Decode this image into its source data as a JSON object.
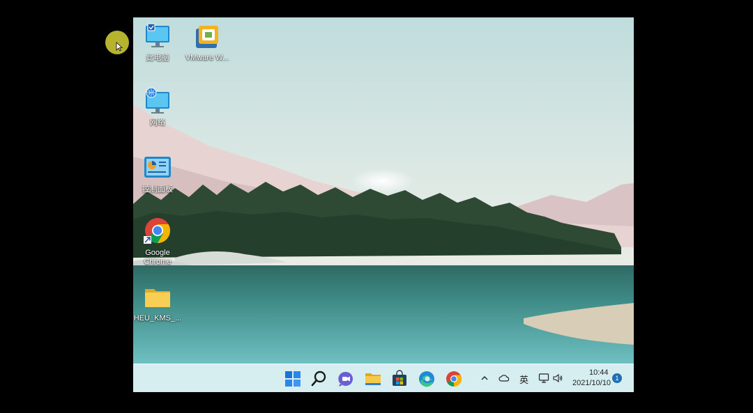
{
  "desktop": {
    "icons": [
      {
        "label": "此电脑",
        "icon": "computer-icon"
      },
      {
        "label": "VMware W...",
        "icon": "vmware-icon"
      },
      {
        "label": "网络",
        "icon": "network-icon"
      },
      {
        "label": "控制面板",
        "icon": "control-panel-icon"
      },
      {
        "label": "Google",
        "label2": "Chrome",
        "icon": "chrome-icon"
      },
      {
        "label": "HEU_KMS_...",
        "icon": "folder-icon"
      }
    ]
  },
  "taskbar": {
    "apps": [
      "start-icon",
      "search-icon",
      "chat-icon",
      "file-explorer-icon",
      "store-icon",
      "edge-icon",
      "chrome-icon"
    ],
    "tray": {
      "ime": "英",
      "time": "10:44",
      "date": "2021/10/10",
      "notifications": "1"
    }
  },
  "colors": {
    "taskbar": "#d7eef0",
    "accent": "#1f6fb5",
    "cursor_halo": "#c6c233"
  }
}
